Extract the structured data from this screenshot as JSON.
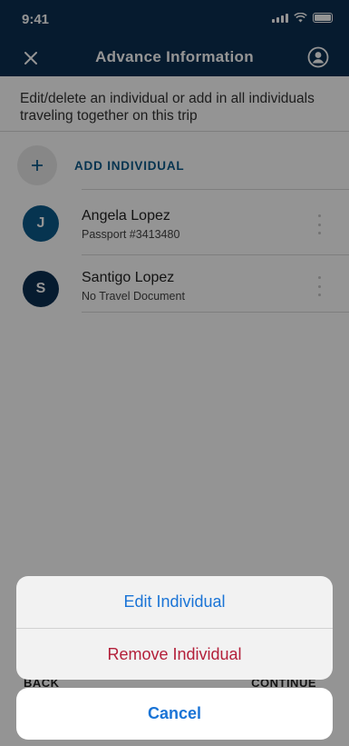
{
  "status_bar": {
    "time": "9:41"
  },
  "nav": {
    "title": "Advance Information",
    "close_icon": "close-icon",
    "profile_icon": "profile-icon"
  },
  "intro_text": "Edit/delete an individual or add in all individuals traveling together on this trip",
  "add_individual": {
    "label": "ADD INDIVIDUAL",
    "icon": "plus"
  },
  "individuals": [
    {
      "initial": "J",
      "name": "Angela Lopez",
      "document": "Passport #3413480",
      "avatar_color": "#0b5a8a"
    },
    {
      "initial": "S",
      "name": "Santigo Lopez",
      "document": "No Travel Document",
      "avatar_color": "#0b2f52"
    }
  ],
  "footer": {
    "back_label": "BACK",
    "continue_label": "CONTINUE"
  },
  "action_sheet": {
    "edit_label": "Edit Individual",
    "remove_label": "Remove Individual",
    "cancel_label": "Cancel"
  },
  "colors": {
    "nav_background": "#0b2f52",
    "accent_blue": "#1a74d6",
    "destructive_red": "#b3203a",
    "link_blue": "#0b5a8a"
  }
}
